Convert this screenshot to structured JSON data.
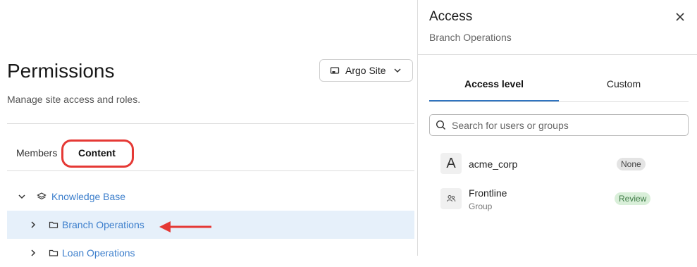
{
  "page": {
    "title": "Permissions",
    "subtitle": "Manage site access and roles.",
    "site_selector": {
      "label": "Argo Site",
      "icon": "site-icon"
    }
  },
  "tabs": [
    {
      "label": "Members",
      "active": false
    },
    {
      "label": "Content",
      "active": true
    }
  ],
  "tree": [
    {
      "label": "Knowledge Base",
      "expanded": true,
      "icon": "layers-icon",
      "selected": false
    },
    {
      "label": "Branch Operations",
      "expanded": false,
      "icon": "folder-icon",
      "selected": true
    },
    {
      "label": "Loan Operations",
      "expanded": false,
      "icon": "folder-icon",
      "selected": false
    }
  ],
  "panel": {
    "title": "Access",
    "subtitle": "Branch Operations",
    "tabs": [
      {
        "label": "Access level",
        "active": true
      },
      {
        "label": "Custom",
        "active": false
      }
    ],
    "search_placeholder": "Search for users or groups",
    "entries": [
      {
        "avatar": "A",
        "name": "acme_corp",
        "sub": "",
        "badge": "None"
      },
      {
        "avatar": "group-icon",
        "name": "Frontline",
        "sub": "Group",
        "badge": "Review"
      }
    ]
  },
  "colors": {
    "accent": "#2f74c0",
    "link": "#3d7fcc",
    "selected_row": "#e6f0fa",
    "annotation": "#e53935"
  }
}
